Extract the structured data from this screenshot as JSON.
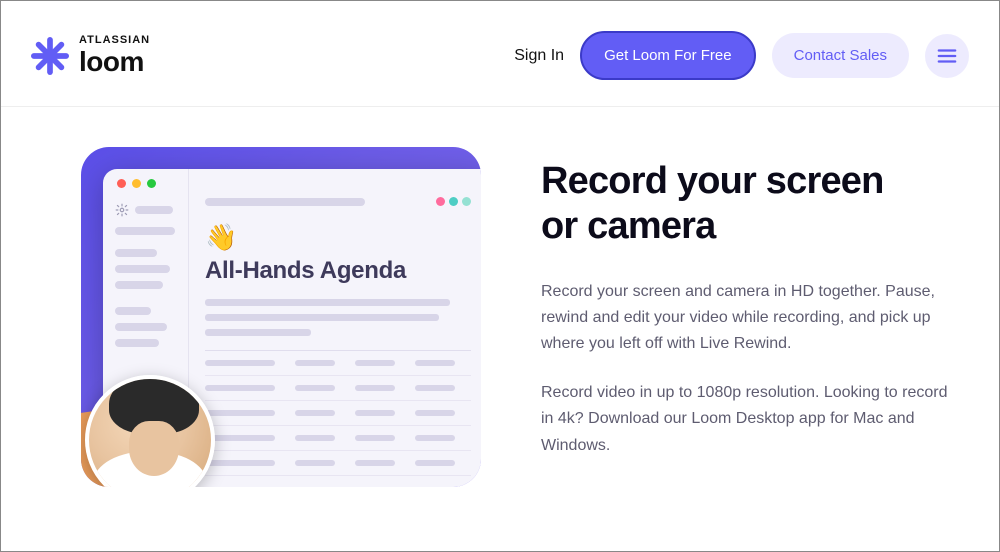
{
  "header": {
    "logo_parent": "ATLASSIAN",
    "logo_name": "loom",
    "sign_in": "Sign In",
    "cta_primary": "Get Loom For Free",
    "cta_secondary": "Contact Sales"
  },
  "illustration": {
    "wave_emoji": "👋",
    "doc_title": "All-Hands Agenda"
  },
  "copy": {
    "heading_line1": "Record your screen",
    "heading_line2": "or camera",
    "paragraph1": "Record your screen and camera in HD together. Pause, rewind and edit your video while recording, and pick up where you left off with Live Rewind.",
    "paragraph2": "Record video in up to 1080p resolution. Looking to record in 4k? Download our Loom Desktop app for Mac and Windows."
  }
}
